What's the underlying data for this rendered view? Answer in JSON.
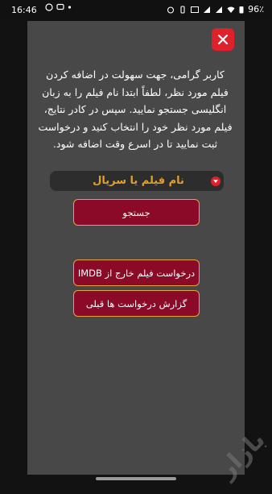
{
  "status_bar": {
    "time": "16:46",
    "battery": "96٪",
    "left_icons": [
      "whatsapp-icon",
      "chat-icon",
      "dot-icon"
    ],
    "right_icons": [
      "alarm-icon",
      "vibrate-icon",
      "hd-icon",
      "volte-icon",
      "signal-icon",
      "signal-icon",
      "wifi-icon",
      "battery-icon"
    ]
  },
  "dialog": {
    "message": "کاربر گرامی، جهت سهولت در اضافه کردن فیلم مورد نظر، لطفاً ابتدا نام فیلم را به زبان انگلیسی جستجو نمایید. سپس در کادر نتایج، فیلم مورد نظر خود را انتخاب کنید و درخواست ثبت نمایید تا در اسرع وقت اضافه شود.",
    "search_placeholder": "نام فیلم یا سریال",
    "search_value": "",
    "search_button": "جستجو",
    "imdb_button": "درخواست فیلم خارج از IMDB",
    "history_button": "گزارش درخواست ها قبلی",
    "accent": "#8b0a27",
    "border": "#e8a23a",
    "close_color": "#e0202a"
  },
  "watermark": {
    "text": "بازار"
  }
}
